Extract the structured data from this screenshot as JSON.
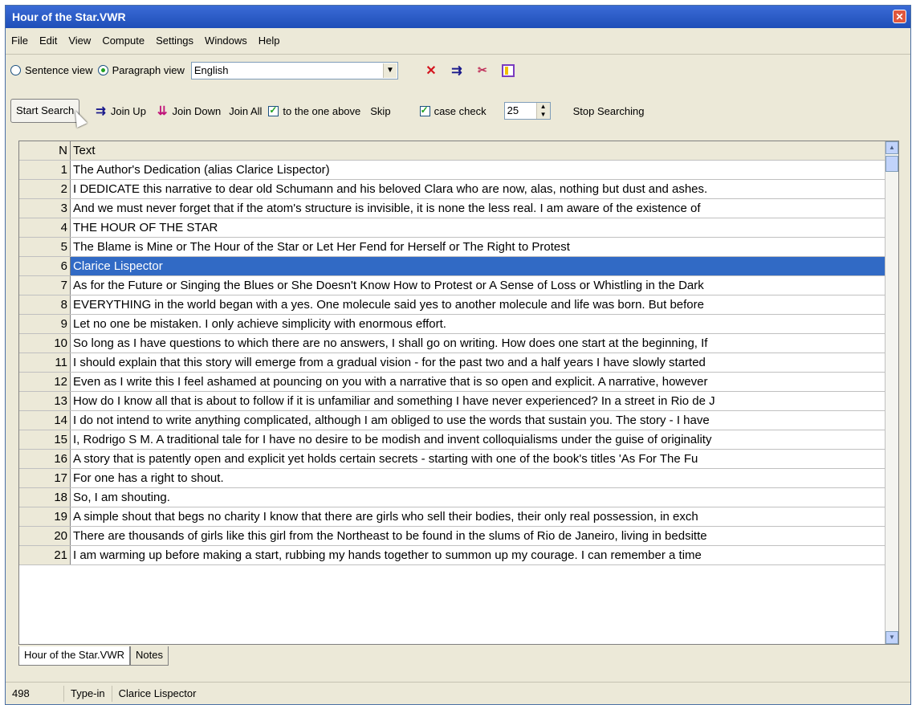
{
  "window": {
    "title": "Hour of the Star.VWR"
  },
  "menu": [
    "File",
    "Edit",
    "View",
    "Compute",
    "Settings",
    "Windows",
    "Help"
  ],
  "toolbar1": {
    "sentence_view": "Sentence view",
    "paragraph_view": "Paragraph view",
    "language": "English",
    "selected_view": "paragraph"
  },
  "toolbar2": {
    "start_search": "Start Search",
    "join_up": "Join Up",
    "join_down": "Join Down",
    "join_all": "Join All",
    "to_one_above": "to the one above",
    "skip": "Skip",
    "case_check": "case check",
    "spin_value": "25",
    "stop_searching": "Stop Searching"
  },
  "grid": {
    "headers": {
      "n": "N",
      "text": "Text"
    },
    "rows": [
      {
        "n": "1",
        "text": "The Author's Dedication (alias Clarice Lispector)"
      },
      {
        "n": "2",
        "text": "I DEDICATE this narrative to dear old Schumann and his beloved Clara who are now, alas, nothing but dust and ashes."
      },
      {
        "n": "3",
        "text": "And we must never forget that if the atom's structure is invisible, it is none the less real. I am aware of the existence of"
      },
      {
        "n": "4",
        "text": "THE HOUR OF THE STAR"
      },
      {
        "n": "5",
        "text": "The Blame is Mine or The Hour of the Star or Let Her Fend for Herself or The Right to Protest"
      },
      {
        "n": "6",
        "text": "Clarice Lispector"
      },
      {
        "n": "7",
        "text": "As for the Future or Singing the Blues or She Doesn't Know How to Protest or A Sense of Loss or Whistling in the Dark"
      },
      {
        "n": "8",
        "text": "EVERYTHING in the world began with a yes. One molecule said yes to another molecule and life was born. But before"
      },
      {
        "n": "9",
        "text": "Let no one be mistaken. I only achieve simplicity with enormous effort."
      },
      {
        "n": "10",
        "text": "So long as I have questions to which there are no answers, I shall go on writing. How does one start at the beginning, If"
      },
      {
        "n": "11",
        "text": "I should explain that this story will emerge from a gradual vision - for the past two and a half years I have slowly started"
      },
      {
        "n": "12",
        "text": "Even as I write this I feel ashamed at pouncing on you with a narrative that is so open and explicit. A narrative, however"
      },
      {
        "n": "13",
        "text": "How do I know all that is about to follow if it is unfamiliar and something I have never experienced? In a street in Rio de J"
      },
      {
        "n": "14",
        "text": "I do not intend to write anything complicated, although I am obliged to use the words that sustain you. The story - I have"
      },
      {
        "n": "15",
        "text": "I, Rodrigo S M. A traditional tale for I have no desire to be modish and invent colloquialisms under the guise of originality"
      },
      {
        "n": "16",
        "text": "A story that is patently open and explicit yet holds certain secrets - starting with one of the book's titles 'As For The Fu"
      },
      {
        "n": "17",
        "text": "For one has a right to shout."
      },
      {
        "n": "18",
        "text": "So, I am shouting."
      },
      {
        "n": "19",
        "text": "A simple shout that begs no charity I know that there are girls who sell their bodies, their only real possession, in exch"
      },
      {
        "n": "20",
        "text": "There are thousands of girls like this girl from the Northeast to be found in the slums of Rio de Janeiro, living in bedsitte"
      },
      {
        "n": "21",
        "text": "I am warming up before making a start, rubbing my hands together to summon up my courage. I can remember a time"
      }
    ],
    "selected_row": 6
  },
  "tabs": [
    "Hour of the Star.VWR",
    "Notes"
  ],
  "status": {
    "count": "498",
    "mode": "Type-in",
    "current": "Clarice Lispector"
  }
}
